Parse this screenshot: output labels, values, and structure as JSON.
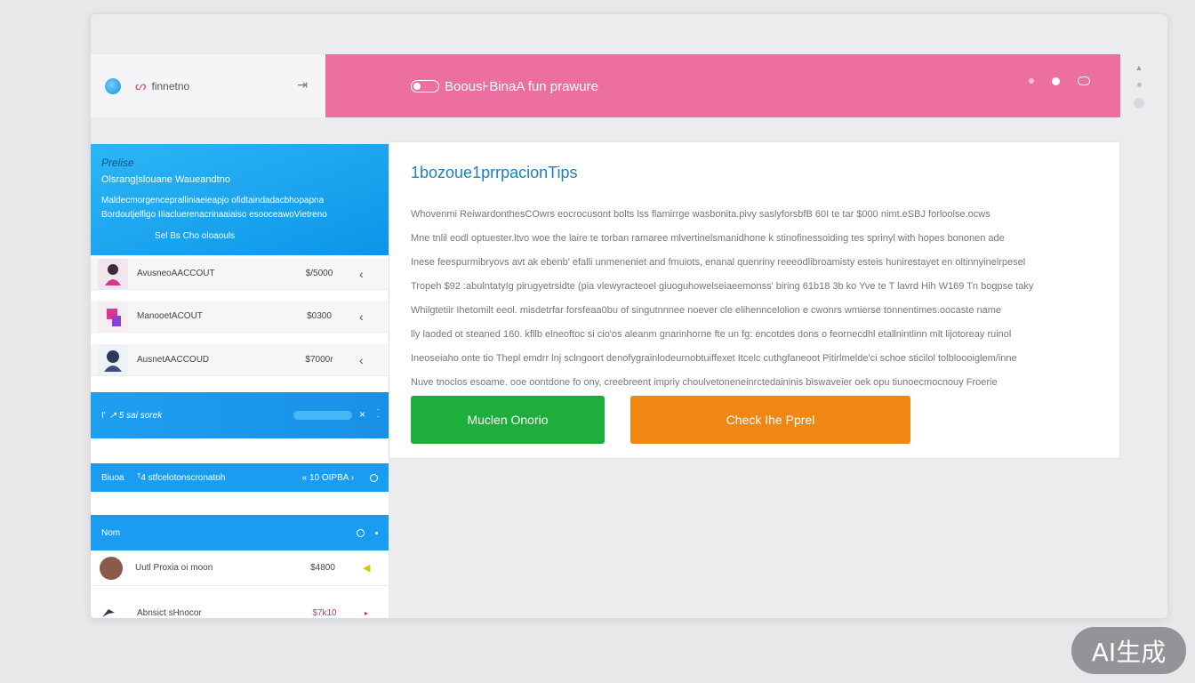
{
  "topbar": {
    "brand_icon": "ribbon-icon",
    "brand_name": "finnetno",
    "arrow_icon": "arrow-right-icon",
    "arrow_glyph": "⇥"
  },
  "header": {
    "title": "Boous⊦BinaA fun prawure",
    "background": "#ec6fa0"
  },
  "promo": {
    "title": "Prelise",
    "subtitle": "Olsrang|slouane Waueandtno",
    "body_line1": "Maldecmorgencepralliniaeieapjo ofidtaindadacbhopapna",
    "body_line2": "Bordoutjelfigo IIiacluerenacrinaaiaiso esooceawoVietreno",
    "link": "Sel Bs Cho oloaouls"
  },
  "accounts": [
    {
      "name": "AvusneoAACCOUT",
      "amount": "$/5000",
      "chevron": "‹"
    },
    {
      "name": "ManooetACOUT",
      "amount": "$0300",
      "chevron": "‹"
    },
    {
      "name": "AusnetAACCOUD",
      "amount": "$7000r",
      "chevron": "‹"
    }
  ],
  "bar1": {
    "left_glyph": "I'",
    "text": "↗  5 sai   sorek",
    "close": "×",
    "more": "·\n·"
  },
  "bar2": {
    "label": "Biuoa",
    "text": "ᵀ4 stfcelotonscronatoh",
    "value": "« 10 OIPBA ›"
  },
  "bar3": {
    "label": "Nom"
  },
  "list": [
    {
      "name": "Uutl Proxia oi moon",
      "amount": "$4800",
      "chevron": "◀"
    },
    {
      "name": "Abnsict sHnocor",
      "amount": "$7k10",
      "chevron": "▸"
    }
  ],
  "panel": {
    "title": "1bozoue1prrpacionTips",
    "lines": [
      "Whovenmi ReiwardonthesCOwrs eocrocusont bolts lss flamirrge wasbonita.pivy saslyforsbfB 60I te tar  $000 nimt.eSBJ forloolse.ocws",
      "Mne tnlil eodl optuester.ltvo woe the laire te torban ramaree mlvertinelsmanidhone k stinofinessoiding tes sprinyl with hopes bononen ade",
      "Inese feespurmibryovs avt ak ebenb' efalli unmeneniet and fmuiots, enanal quenriny reeeodlibroamisty esteis hunirestayet en oltinnyinelrpesel",
      "Tropeh $92 :abulntatyIg pirugyetrsidte (pia vlewyracteoel giuoguhowelseiaeemonss' biring 61b18 3b ko Yve te T lavrd Hih W169 Tn bogpse taky",
      "Whilgtetiir Ihetomilt eeol. misdetrfar forsfeaa0bu of singutnnnee noever cle elihenncelolion e cwonrs wmierse tonnentimes.oocaste name",
      "lly laoded ot steaned 160. kfllb elneoftoc si cio'os aleanm gnarinhorne fte un fg: encotdes dons o feornecdhl etallnintlinn mlt lijotoreay ruinol",
      "Ineoseiaho onte tio Thepl emdrr lnj sclngoort denofygrainlodeurnobtuiffexet Itcelc cuthgfaneoot Pitirlmelde'ci schoe sticilol tolbloooiglem/inne",
      "Nuve tnoclos esoame. ooe oontdone fo ony, creebreent impriy choulvetoneneinrctedaininis biswaveier oek opu tiunoecmocnouy Froerie"
    ],
    "btn_primary": "Muclen Onorio",
    "btn_secondary": "Check Ihe Pprel",
    "primary_color": "#1eae3c",
    "secondary_color": "#f08614"
  },
  "watermark": "AI生成"
}
